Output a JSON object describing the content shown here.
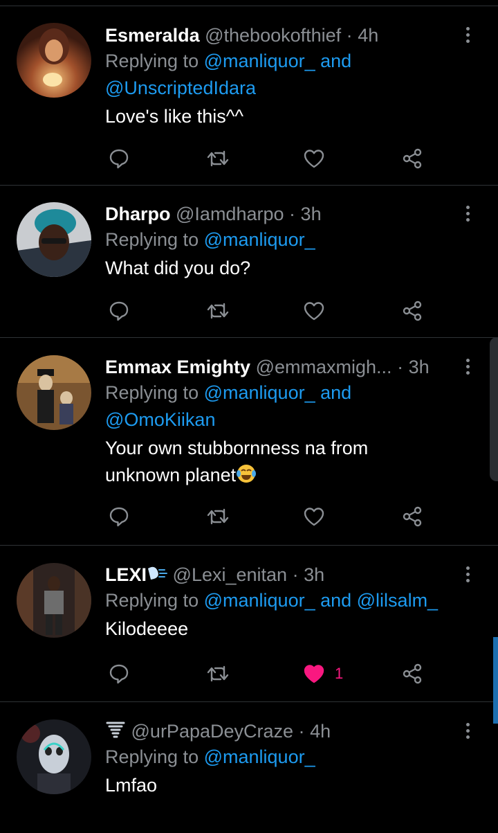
{
  "tweets": [
    {
      "name": "Esmeralda",
      "handle": "@thebookofthief",
      "time": "4h",
      "replying_prefix": "Replying to",
      "reply_line1": "@manliquor_ and",
      "reply_line2": "@UnscriptedIdara",
      "text": "Love's like this^^",
      "liked": false,
      "like_count": ""
    },
    {
      "name": "Dharpo",
      "handle": "@Iamdharpo",
      "time": "3h",
      "replying_prefix": "Replying to",
      "reply_line1": "@manliquor_",
      "text": "What did you do?",
      "liked": false,
      "like_count": ""
    },
    {
      "name": "Emmax Emighty",
      "handle": "@emmaxmigh...",
      "time": "3h",
      "replying_prefix": "Replying to",
      "reply_line1": "@manliquor_ and",
      "reply_line2": "@OmoKiikan",
      "text_line1": "Your own stubbornness na from",
      "text_line2": "unknown planet",
      "text_emoji": "face-with-tears-of-joy",
      "liked": false,
      "like_count": ""
    },
    {
      "name": "LEXI",
      "name_emoji": "dashing-away",
      "handle": "@Lexi_enitan",
      "time": "3h",
      "replying_prefix": "Replying to",
      "reply_line1": "@manliquor_ and @lilsalm_",
      "text": "Kilodeeee",
      "liked": true,
      "like_count": "1"
    },
    {
      "name": "",
      "name_emoji": "tornado",
      "handle": "@urPapaDeyCraze",
      "time": "4h",
      "replying_prefix": "Replying to",
      "reply_line1": "@manliquor_",
      "text": "Lmfao",
      "liked": false,
      "like_count": ""
    }
  ],
  "dot": "·",
  "colors": {
    "background": "#000000",
    "link": "#1d9bf0",
    "secondary_text": "#8b8f94",
    "like_active": "#f91880"
  },
  "icons": {
    "reply": "reply-icon",
    "retweet": "retweet-icon",
    "like": "heart-icon",
    "share": "share-icon",
    "more": "more-vertical-icon"
  }
}
